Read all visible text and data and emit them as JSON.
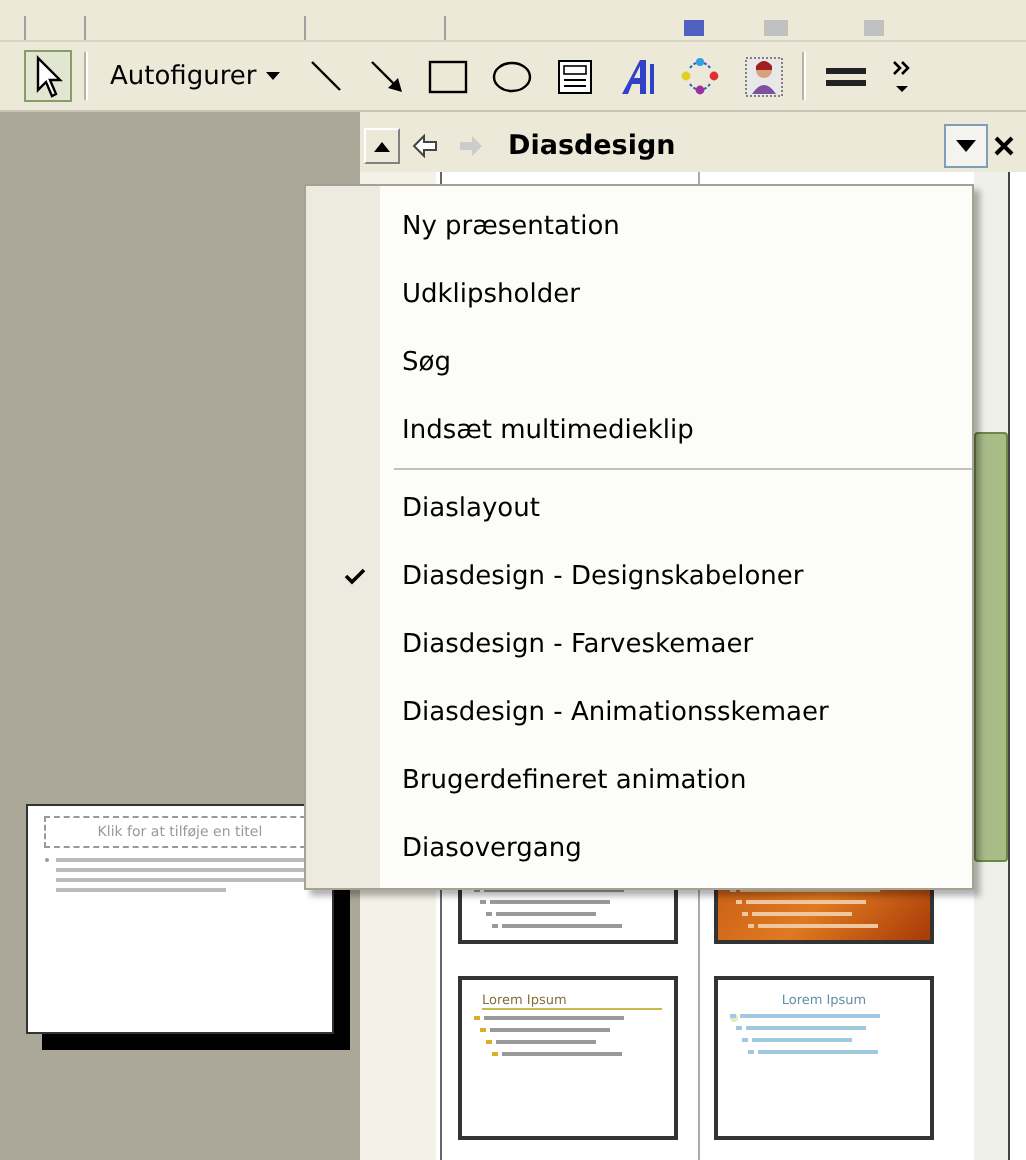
{
  "toolbar": {
    "autoshapes_label": "Autofigurer"
  },
  "task_pane": {
    "title": "Diasdesign"
  },
  "menu": {
    "sections": [
      {
        "items": [
          {
            "label": "Ny præsentation",
            "checked": false
          },
          {
            "label": "Udklipsholder",
            "checked": false
          },
          {
            "label": "Søg",
            "checked": false
          },
          {
            "label": "Indsæt multimedieklip",
            "checked": false
          }
        ]
      },
      {
        "items": [
          {
            "label": "Diaslayout",
            "checked": false
          },
          {
            "label": "Diasdesign - Designskabeloner",
            "checked": true
          },
          {
            "label": "Diasdesign - Farveskemaer",
            "checked": false
          },
          {
            "label": "Diasdesign - Animationsskemaer",
            "checked": false
          },
          {
            "label": "Brugerdefineret animation",
            "checked": false
          },
          {
            "label": "Diasovergang",
            "checked": false
          }
        ]
      }
    ]
  },
  "slide": {
    "title_placeholder": "Klik for at tilføje en titel"
  },
  "designs": [
    {
      "kind": "white"
    },
    {
      "kind": "orange"
    },
    {
      "kind": "bracket",
      "title": "Lorem Ipsum"
    },
    {
      "kind": "pastel",
      "title": "Lorem Ipsum"
    }
  ]
}
